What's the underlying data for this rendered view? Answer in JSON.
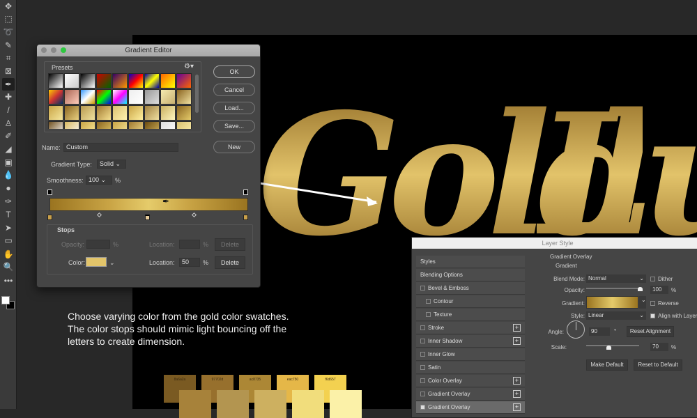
{
  "toolbar": {
    "tools": [
      {
        "name": "move-tool-icon",
        "glyph": "✥"
      },
      {
        "name": "marquee-tool-icon",
        "glyph": "⬚"
      },
      {
        "name": "lasso-tool-icon",
        "glyph": "➰"
      },
      {
        "name": "quick-select-tool-icon",
        "glyph": "✎"
      },
      {
        "name": "crop-tool-icon",
        "glyph": "⌗"
      },
      {
        "name": "frame-tool-icon",
        "glyph": "⊠"
      },
      {
        "name": "eyedropper-tool-icon",
        "glyph": "✒"
      },
      {
        "name": "healing-brush-tool-icon",
        "glyph": "✚"
      },
      {
        "name": "brush-tool-icon",
        "glyph": "/"
      },
      {
        "name": "clone-stamp-tool-icon",
        "glyph": "♙"
      },
      {
        "name": "history-brush-tool-icon",
        "glyph": "✐"
      },
      {
        "name": "eraser-tool-icon",
        "glyph": "◢"
      },
      {
        "name": "gradient-tool-icon",
        "glyph": "▣"
      },
      {
        "name": "blur-tool-icon",
        "glyph": "💧"
      },
      {
        "name": "dodge-tool-icon",
        "glyph": "●"
      },
      {
        "name": "pen-tool-icon",
        "glyph": "✑"
      },
      {
        "name": "type-tool-icon",
        "glyph": "T"
      },
      {
        "name": "path-select-tool-icon",
        "glyph": "➤"
      },
      {
        "name": "rectangle-tool-icon",
        "glyph": "▭"
      },
      {
        "name": "hand-tool-icon",
        "glyph": "✋"
      },
      {
        "name": "zoom-tool-icon",
        "glyph": "🔍"
      },
      {
        "name": "more-tools-icon",
        "glyph": "•••"
      }
    ],
    "foreground_color": "#ffffff",
    "background_color": "#000000"
  },
  "canvas": {
    "word1": "Gold",
    "word2": "Lux",
    "instruction": "Choose varying color from the gold color swatches. The color stops should mimic light bouncing off the letters  to create dimension.",
    "swatches_row1": [
      {
        "label": "8a6a2a",
        "color": "#7a5a22"
      },
      {
        "label": "97702d",
        "color": "#97702d"
      },
      {
        "label": "ac8735",
        "color": "#ac8735"
      },
      {
        "label": "eac750",
        "color": "#e5b748"
      },
      {
        "label": "f6d657",
        "color": "#f3d150"
      }
    ],
    "swatches_row2": [
      {
        "color": "#a7823a"
      },
      {
        "color": "#b39550"
      },
      {
        "color": "#cdb060"
      },
      {
        "color": "#f1dd7c"
      },
      {
        "color": "#fbf1a8"
      }
    ]
  },
  "gradient_editor": {
    "title": "Gradient Editor",
    "presets_label": "Presets",
    "buttons": {
      "ok": "OK",
      "cancel": "Cancel",
      "load": "Load...",
      "save": "Save...",
      "new": "New"
    },
    "name_label": "Name:",
    "name_value": "Custom",
    "gradient_type_label": "Gradient Type:",
    "gradient_type_value": "Solid",
    "smoothness_label": "Smoothness:",
    "smoothness_value": "100",
    "percent": "%",
    "stops_label": "Stops",
    "opacity_label": "Opacity:",
    "location_label": "Location:",
    "delete_label": "Delete",
    "color_label": "Color:",
    "color_value": "#e2c46a",
    "location_value": "50",
    "presets": [
      "#000,#fff",
      "#fff,#ccc",
      "#000,#fff",
      "#c00,#060",
      "#306,#f90",
      "#00c,#f00,#ff0",
      "#00a,#ff0,#00a",
      "#f60,#ff0",
      "#609,#f60",
      "#fc0,#c33,#036",
      "#a65,#fcb",
      "#39f,#fff,#c90",
      "#f00,#0f0,#00f",
      "#fff,#f0f,#0ff",
      "#eee,#fff",
      "#999,#ddd",
      "#f5eab0,#c8b070",
      "#8a6420,#f0e0a0",
      "#c9a445,#f5e79e",
      "#8a6420,#e8d080",
      "#b89a50,#f0e2a0",
      "#a07830,#f5e090",
      "#d8c070,#fff2b0",
      "#c9a445,#fff0a0",
      "#a08040,#f0e0a0",
      "#c9b060,#fff7c0",
      "#8a6420,#e5cb6a",
      "#705020,#fff",
      "#d8b860,#fff",
      "#c9a445,#fff0a0",
      "#8a6420,#e5cb6a",
      "#c9a445,#f5e79e",
      "#a07830,#f5e090",
      "#6a4a10,#d8b860",
      "#ddd,#fff",
      "#d8c070,#fff2b0"
    ]
  },
  "layer_style": {
    "title": "Layer Style",
    "styles_list": [
      {
        "label": "Styles",
        "checkbox": false,
        "indent": false,
        "plus": false,
        "checked": false
      },
      {
        "label": "Blending Options",
        "checkbox": false,
        "indent": false,
        "plus": false,
        "checked": false
      },
      {
        "label": "Bevel & Emboss",
        "checkbox": true,
        "indent": false,
        "plus": false,
        "checked": false
      },
      {
        "label": "Contour",
        "checkbox": true,
        "indent": true,
        "plus": false,
        "checked": false
      },
      {
        "label": "Texture",
        "checkbox": true,
        "indent": true,
        "plus": false,
        "checked": false
      },
      {
        "label": "Stroke",
        "checkbox": true,
        "indent": false,
        "plus": true,
        "checked": false
      },
      {
        "label": "Inner Shadow",
        "checkbox": true,
        "indent": false,
        "plus": true,
        "checked": false
      },
      {
        "label": "Inner Glow",
        "checkbox": true,
        "indent": false,
        "plus": false,
        "checked": false
      },
      {
        "label": "Satin",
        "checkbox": true,
        "indent": false,
        "plus": false,
        "checked": false
      },
      {
        "label": "Color Overlay",
        "checkbox": true,
        "indent": false,
        "plus": true,
        "checked": false
      },
      {
        "label": "Gradient Overlay",
        "checkbox": true,
        "indent": false,
        "plus": true,
        "checked": false
      },
      {
        "label": "Gradient Overlay",
        "checkbox": true,
        "indent": false,
        "plus": true,
        "checked": true
      }
    ],
    "section_title": "Gradient Overlay",
    "subsection_title": "Gradient",
    "blend_mode_label": "Blend Mode:",
    "blend_mode_value": "Normal",
    "dither_label": "Dither",
    "opacity_label": "Opacity:",
    "opacity_value": "100",
    "percent": "%",
    "gradient_label": "Gradient:",
    "reverse_label": "Reverse",
    "style_label": "Style:",
    "style_value": "Linear",
    "align_label": "Align with Layer",
    "angle_label": "Angle:",
    "angle_value": "90",
    "degree": "°",
    "reset_alignment": "Reset Alignment",
    "scale_label": "Scale:",
    "scale_value": "70",
    "make_default": "Make Default",
    "reset_default": "Reset to Default"
  }
}
